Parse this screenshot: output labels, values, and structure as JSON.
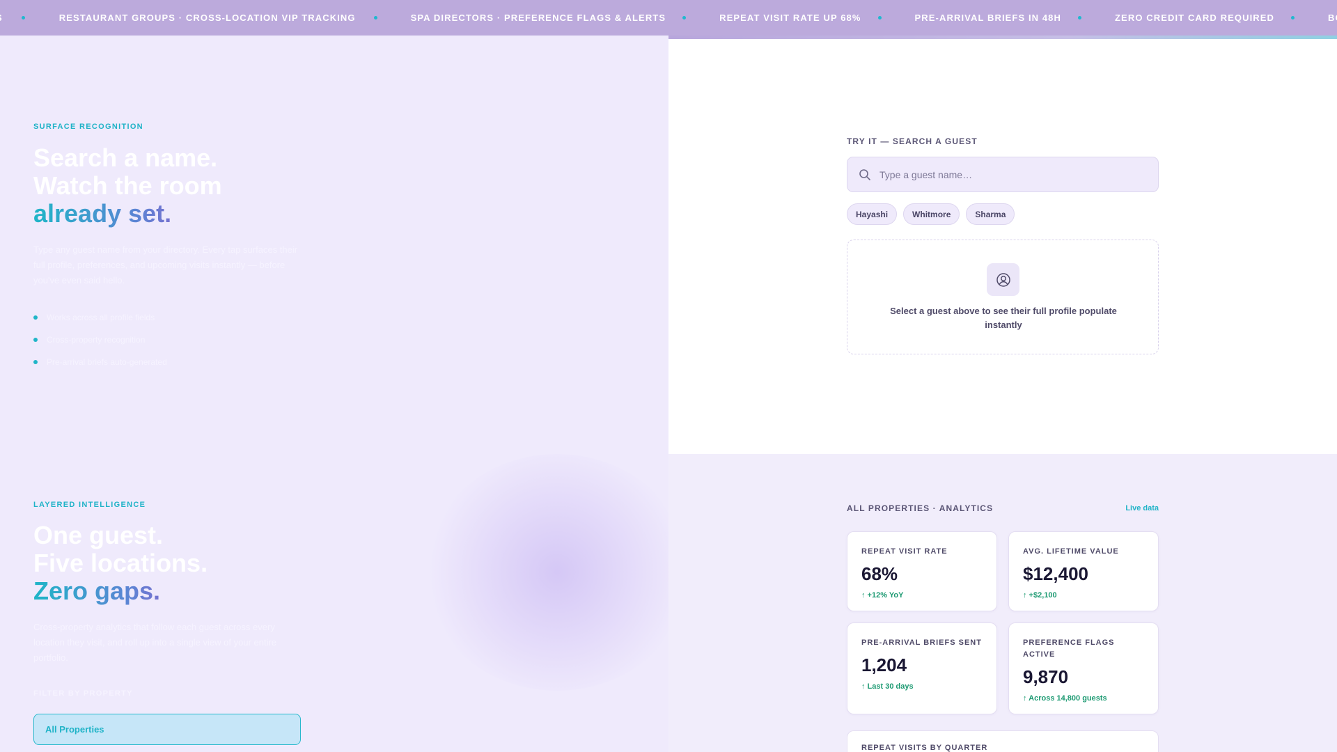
{
  "ticker": {
    "items": [
      "S",
      "RESTAURANT GROUPS · CROSS-LOCATION VIP TRACKING",
      "SPA DIRECTORS · PREFERENCE FLAGS & ALERTS",
      "REPEAT VISIT RATE UP 68%",
      "PRE-ARRIVAL BRIEFS IN 48H",
      "ZERO CREDIT CARD REQUIRED",
      "BOUTIQUE HO"
    ]
  },
  "recognition": {
    "eyebrow": "SURFACE RECOGNITION",
    "headline_line1": "Search a name.",
    "headline_line2": "Watch the room",
    "headline_line3": "already set.",
    "lede": "Type any guest name from your directory. Every tap surfaces their full profile, preferences, and upcoming visits instantly — before you've even said hello.",
    "bullets": [
      "Works across all profile fields",
      "Cross-property recognition",
      "Pre-arrival briefs auto-generated"
    ]
  },
  "demo": {
    "label": "TRY IT — SEARCH A GUEST",
    "search_placeholder": "Type a guest name…",
    "chips": [
      "Hayashi",
      "Whitmore",
      "Sharma"
    ],
    "empty_text": "Select a guest above to see their full profile populate instantly"
  },
  "intelligence": {
    "eyebrow": "LAYERED INTELLIGENCE",
    "headline_line1": "One guest.",
    "headline_line2": "Five locations.",
    "headline_line3": "Zero gaps.",
    "lede": "Cross-property analytics that follow each guest across every location they visit, and roll up into a single view of your entire portfolio.",
    "filter_label": "FILTER BY PROPERTY",
    "filter_selected": "All Properties"
  },
  "analytics": {
    "title": "ALL PROPERTIES · ANALYTICS",
    "live_label": "Live data",
    "cards": [
      {
        "label": "REPEAT VISIT RATE",
        "value": "68%",
        "delta": "↑ +12% YoY"
      },
      {
        "label": "AVG. LIFETIME VALUE",
        "value": "$12,400",
        "delta": "↑ +$2,100"
      },
      {
        "label": "PRE-ARRIVAL BRIEFS SENT",
        "value": "1,204",
        "delta": "↑ Last 30 days"
      },
      {
        "label": "PREFERENCE FLAGS ACTIVE",
        "value": "9,870",
        "delta": "↑ Across 14,800 guests"
      }
    ],
    "chart_title": "REPEAT VISITS BY QUARTER"
  },
  "colors": {
    "accent_teal": "#1fb5c7",
    "accent_purple": "#9b56c9",
    "ticker_bg": "#bcaadc",
    "delta_green": "#1d9a72"
  }
}
